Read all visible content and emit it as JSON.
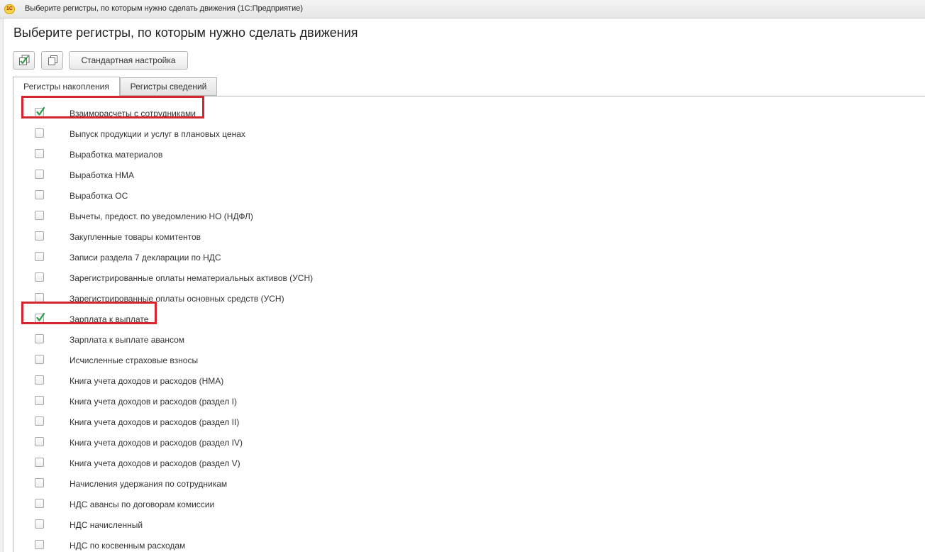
{
  "window": {
    "title": "Выберите регистры, по которым нужно сделать движения  (1С:Предприятие)",
    "logo_text": "1С"
  },
  "form": {
    "title": "Выберите регистры, по которым нужно сделать движения"
  },
  "toolbar": {
    "check_all_icon": "check-all-icon",
    "uncheck_all_icon": "uncheck-all-icon",
    "standard_settings_label": "Стандартная настройка"
  },
  "tabs": [
    {
      "label": "Регистры накопления",
      "active": true
    },
    {
      "label": "Регистры сведений",
      "active": false
    }
  ],
  "registers": [
    {
      "label": "Взаиморасчеты с сотрудниками",
      "checked": true,
      "highlighted": true
    },
    {
      "label": "Выпуск продукции и услуг в плановых ценах",
      "checked": false
    },
    {
      "label": "Выработка материалов",
      "checked": false
    },
    {
      "label": "Выработка НМА",
      "checked": false
    },
    {
      "label": "Выработка ОС",
      "checked": false
    },
    {
      "label": "Вычеты, предост. по уведомлению НО (НДФЛ)",
      "checked": false
    },
    {
      "label": "Закупленные товары комитентов",
      "checked": false
    },
    {
      "label": "Записи раздела 7 декларации по НДС",
      "checked": false
    },
    {
      "label": "Зарегистрированные оплаты нематериальных активов (УСН)",
      "checked": false
    },
    {
      "label": "Зарегистрированные оплаты основных средств (УСН)",
      "checked": false
    },
    {
      "label": "Зарплата к выплате",
      "checked": true,
      "highlighted": true
    },
    {
      "label": "Зарплата к выплате авансом",
      "checked": false
    },
    {
      "label": "Исчисленные страховые взносы",
      "checked": false
    },
    {
      "label": "Книга учета доходов и расходов (НМА)",
      "checked": false
    },
    {
      "label": "Книга учета доходов и расходов (раздел I)",
      "checked": false
    },
    {
      "label": "Книга учета доходов и расходов (раздел II)",
      "checked": false
    },
    {
      "label": "Книга учета доходов и расходов (раздел IV)",
      "checked": false
    },
    {
      "label": "Книга учета доходов и расходов (раздел V)",
      "checked": false
    },
    {
      "label": "Начисления удержания по сотрудникам",
      "checked": false
    },
    {
      "label": "НДС авансы по договорам комиссии",
      "checked": false
    },
    {
      "label": "НДС начисленный",
      "checked": false
    },
    {
      "label": "НДС по косвенным расходам",
      "checked": false
    }
  ],
  "colors": {
    "highlight": "#d7252d",
    "checkmark": "#2e9a4a"
  }
}
